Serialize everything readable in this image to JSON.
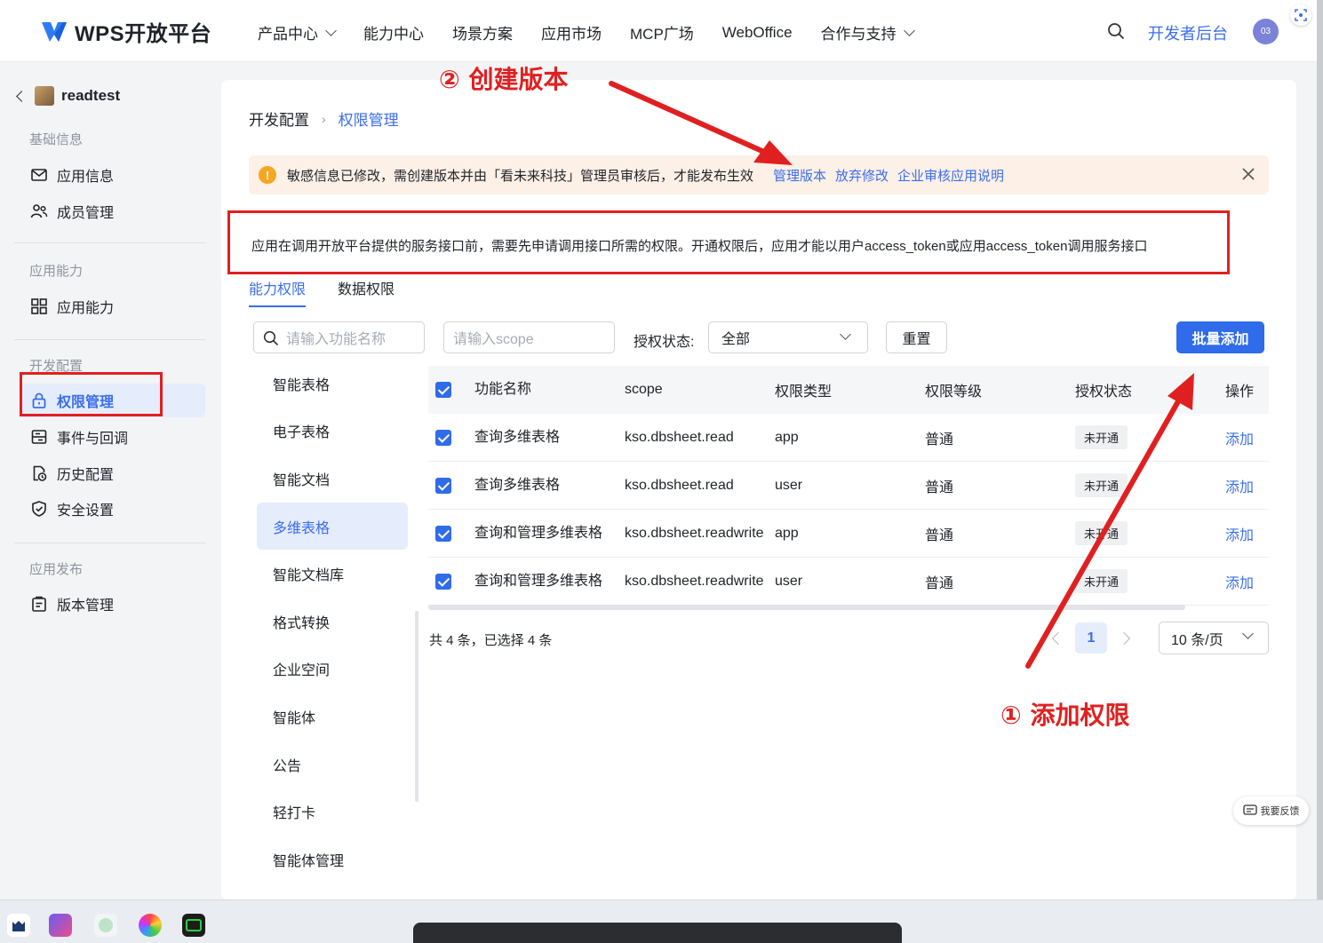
{
  "header": {
    "logo_text": "WPS开放平台",
    "nav": [
      {
        "label": "产品中心",
        "dropdown": true
      },
      {
        "label": "能力中心",
        "dropdown": false
      },
      {
        "label": "场景方案",
        "dropdown": false
      },
      {
        "label": "应用市场",
        "dropdown": false
      },
      {
        "label": "MCP广场",
        "dropdown": false
      },
      {
        "label": "WebOffice",
        "dropdown": false
      },
      {
        "label": "合作与支持",
        "dropdown": true
      }
    ],
    "dev_console": "开发者后台",
    "avatar_text": "03"
  },
  "sidebar": {
    "app_name": "readtest",
    "groups": [
      {
        "title": "基础信息",
        "items": [
          {
            "label": "应用信息",
            "icon": "mail-icon"
          },
          {
            "label": "成员管理",
            "icon": "members-icon"
          }
        ]
      },
      {
        "title": "应用能力",
        "items": [
          {
            "label": "应用能力",
            "icon": "grid-icon"
          }
        ]
      },
      {
        "title": "开发配置",
        "items": [
          {
            "label": "权限管理",
            "icon": "lock-icon",
            "active": true
          },
          {
            "label": "事件与回调",
            "icon": "event-icon"
          },
          {
            "label": "历史配置",
            "icon": "history-icon"
          },
          {
            "label": "安全设置",
            "icon": "shield-icon"
          }
        ]
      },
      {
        "title": "应用发布",
        "items": [
          {
            "label": "版本管理",
            "icon": "version-icon"
          }
        ]
      }
    ]
  },
  "breadcrumb": {
    "parent": "开发配置",
    "separator": "›",
    "current": "权限管理"
  },
  "notice": {
    "text": "敏感信息已修改，需创建版本并由「看未来科技」管理员审核后，才能发布生效",
    "links": [
      "管理版本",
      "放弃修改",
      "企业审核应用说明"
    ]
  },
  "description": "应用在调用开放平台提供的服务接口前，需要先申请调用接口所需的权限。开通权限后，应用才能以用户access_token或应用access_token调用服务接口",
  "tabs": [
    {
      "label": "能力权限",
      "active": true
    },
    {
      "label": "数据权限",
      "active": false
    }
  ],
  "filters": {
    "name_placeholder": "请输入功能名称",
    "scope_placeholder": "请输入scope",
    "status_label": "授权状态:",
    "status_value": "全部",
    "reset_label": "重置",
    "batch_add_label": "批量添加"
  },
  "categories": [
    {
      "label": "智能表格",
      "active": false
    },
    {
      "label": "电子表格",
      "active": false
    },
    {
      "label": "智能文档",
      "active": false
    },
    {
      "label": "多维表格",
      "active": true
    },
    {
      "label": "智能文档库",
      "active": false
    },
    {
      "label": "格式转换",
      "active": false
    },
    {
      "label": "企业空间",
      "active": false
    },
    {
      "label": "智能体",
      "active": false
    },
    {
      "label": "公告",
      "active": false
    },
    {
      "label": "轻打卡",
      "active": false
    },
    {
      "label": "智能体管理",
      "active": false
    }
  ],
  "table": {
    "columns": [
      "功能名称",
      "scope",
      "权限类型",
      "权限等级",
      "授权状态",
      "操作"
    ],
    "rows": [
      {
        "name": "查询多维表格",
        "scope": "kso.dbsheet.read",
        "type": "app",
        "level": "普通",
        "status": "未开通",
        "action": "添加"
      },
      {
        "name": "查询多维表格",
        "scope": "kso.dbsheet.read",
        "type": "user",
        "level": "普通",
        "status": "未开通",
        "action": "添加"
      },
      {
        "name": "查询和管理多维表格",
        "scope": "kso.dbsheet.readwrite",
        "type": "app",
        "level": "普通",
        "status": "未开通",
        "action": "添加"
      },
      {
        "name": "查询和管理多维表格",
        "scope": "kso.dbsheet.readwrite",
        "type": "user",
        "level": "普通",
        "status": "未开通",
        "action": "添加"
      }
    ]
  },
  "footer": {
    "count_text": "共 4 条，已选择 4 条",
    "current_page": "1",
    "page_size": "10 条/页"
  },
  "annotations": {
    "step1": "① 添加权限",
    "step2": "② 创建版本"
  },
  "feedback": "我要反馈",
  "colors": {
    "accent": "#3a6df0",
    "annotation": "#e02020",
    "notice_bg": "#fdf0e6"
  }
}
